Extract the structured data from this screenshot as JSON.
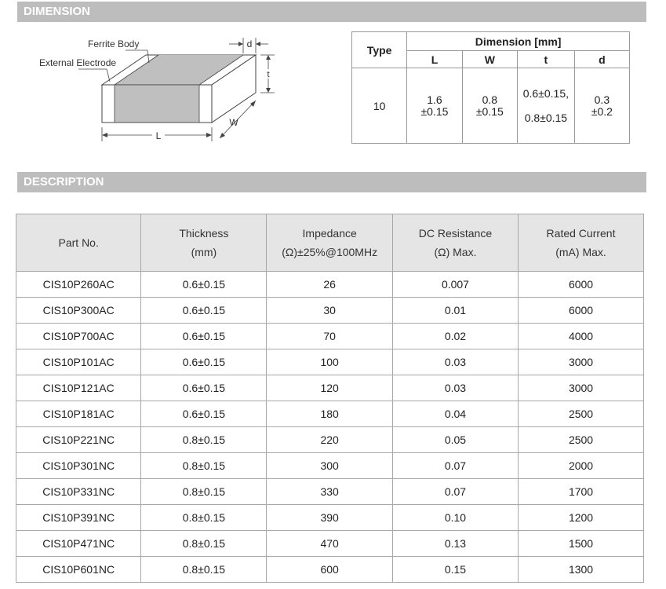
{
  "sections": {
    "dimension": "DIMENSION",
    "description": "DESCRIPTION"
  },
  "diagram": {
    "ferrite_body": "Ferrite Body",
    "external_electrode": "External Electrode",
    "label_d": "d",
    "label_t": "t",
    "label_w": "W",
    "label_l": "L"
  },
  "dimension_table": {
    "type_header": "Type",
    "dimension_header": "Dimension [mm]",
    "columns": [
      "L",
      "W",
      "t",
      "d"
    ],
    "type_value": "10",
    "L": [
      "1.6",
      "±0.15"
    ],
    "W": [
      "0.8",
      "±0.15"
    ],
    "t": [
      "0.6±0.15,",
      "0.8±0.15"
    ],
    "d": [
      "0.3",
      "±0.2"
    ]
  },
  "description_table": {
    "headers": [
      [
        "Part No."
      ],
      [
        "Thickness",
        "(mm)"
      ],
      [
        "Impedance",
        "(Ω)±25%@100MHz"
      ],
      [
        "DC  Resistance",
        "(Ω)  Max."
      ],
      [
        "Rated  Current",
        "(mA)  Max."
      ]
    ],
    "rows": [
      [
        "CIS10P260AC",
        "0.6±0.15",
        "26",
        "0.007",
        "6000"
      ],
      [
        "CIS10P300AC",
        "0.6±0.15",
        "30",
        "0.01",
        "6000"
      ],
      [
        "CIS10P700AC",
        "0.6±0.15",
        "70",
        "0.02",
        "4000"
      ],
      [
        "CIS10P101AC",
        "0.6±0.15",
        "100",
        "0.03",
        "3000"
      ],
      [
        "CIS10P121AC",
        "0.6±0.15",
        "120",
        "0.03",
        "3000"
      ],
      [
        "CIS10P181AC",
        "0.6±0.15",
        "180",
        "0.04",
        "2500"
      ],
      [
        "CIS10P221NC",
        "0.8±0.15",
        "220",
        "0.05",
        "2500"
      ],
      [
        "CIS10P301NC",
        "0.8±0.15",
        "300",
        "0.07",
        "2000"
      ],
      [
        "CIS10P331NC",
        "0.8±0.15",
        "330",
        "0.07",
        "1700"
      ],
      [
        "CIS10P391NC",
        "0.8±0.15",
        "390",
        "0.10",
        "1200"
      ],
      [
        "CIS10P471NC",
        "0.8±0.15",
        "470",
        "0.13",
        "1500"
      ],
      [
        "CIS10P601NC",
        "0.8±0.15",
        "600",
        "0.15",
        "1300"
      ]
    ]
  }
}
